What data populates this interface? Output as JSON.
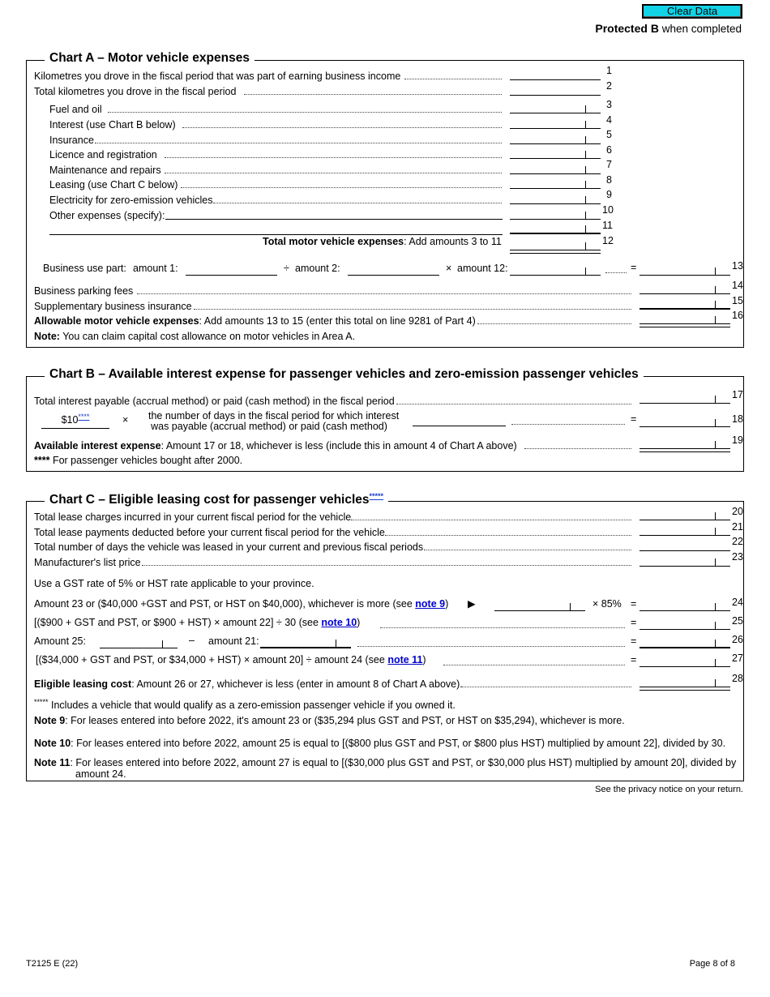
{
  "header": {
    "clear_button": "Clear Data",
    "protected_bold": "Protected B",
    "protected_rest": " when completed"
  },
  "chart_a": {
    "title": "Chart A – Motor vehicle expenses",
    "lines": [
      {
        "num": "1",
        "label": "Kilometres you drove in the fiscal period that was part of earning business income"
      },
      {
        "num": "2",
        "label": "Total kilometres you drove in the fiscal period"
      },
      {
        "num": "3",
        "label": "Fuel and oil"
      },
      {
        "num": "4",
        "label": "Interest (use Chart B below)"
      },
      {
        "num": "5",
        "label": "Insurance"
      },
      {
        "num": "6",
        "label": "Licence and registration"
      },
      {
        "num": "7",
        "label": "Maintenance and repairs"
      },
      {
        "num": "8",
        "label": "Leasing (use Chart C below)"
      },
      {
        "num": "9",
        "label": "Electricity for zero-emission vehicles"
      },
      {
        "num": "10",
        "label": "Other expenses (specify):"
      },
      {
        "num": "11",
        "label": ""
      },
      {
        "num": "12",
        "label_bold": "Total motor vehicle expenses",
        "label_rest": ": Add amounts 3 to 11"
      }
    ],
    "business_use": {
      "label": "Business use part:",
      "amount1": "amount 1:",
      "divide": "÷",
      "amount2": "amount 2:",
      "times": "×",
      "amount12": "amount 12:",
      "equals": "=",
      "num": "13"
    },
    "line14": {
      "num": "14",
      "label": "Business parking fees"
    },
    "line15": {
      "num": "15",
      "label": "Supplementary business insurance"
    },
    "line16": {
      "num": "16",
      "label_bold": "Allowable motor vehicle expenses",
      "label_rest": ": Add amounts 13 to 15 (enter this total on line 9281 of Part 4)"
    },
    "note_bold": "Note:",
    "note_rest": " You can claim capital cost allowance on motor vehicles in Area A."
  },
  "chart_b": {
    "title": "Chart B – Available interest expense for passenger vehicles and zero-emission passenger vehicles",
    "line17": {
      "num": "17",
      "label": "Total interest payable (accrual method) or paid (cash method) in the fiscal period"
    },
    "line18": {
      "num": "18",
      "amount": "$10",
      "stars": "****",
      "times": "×",
      "desc_line1": "the number of days in the fiscal period for which interest",
      "desc_line2": "was payable (accrual method) or paid (cash method)",
      "equals": "="
    },
    "line19": {
      "num": "19",
      "label_bold": "Available interest expense",
      "label_rest": ": Amount 17 or 18, whichever is less (include this in amount 4 of Chart A above)"
    },
    "footnote_stars": "****",
    "footnote": " For passenger vehicles bought after 2000."
  },
  "chart_c": {
    "title": "Chart C – Eligible leasing cost for passenger vehicles",
    "title_stars": "*****",
    "line20": {
      "num": "20",
      "label": "Total lease charges incurred in your current fiscal period for the vehicle"
    },
    "line21": {
      "num": "21",
      "label": "Total lease payments deducted before your current fiscal period for the vehicle"
    },
    "line22": {
      "num": "22",
      "label": "Total number of days the vehicle was leased in your current and previous fiscal periods"
    },
    "line23": {
      "num": "23",
      "label": "Manufacturer's list price"
    },
    "gst_note": "Use a GST rate of 5% or HST rate applicable to your province.",
    "line24": {
      "num": "24",
      "label": "Amount 23 or ($40,000 +GST and PST, or HST on $40,000), whichever is more (see ",
      "link": "note 9",
      "close": ")",
      "arrow": "▶",
      "mult": "× 85%",
      "equals": "="
    },
    "line25": {
      "num": "25",
      "label": "[($900 + GST and PST, or $900 + HST) × amount 22]  ÷ 30 (see ",
      "link": "note 10",
      "close": ")",
      "equals": "="
    },
    "line26": {
      "num": "26",
      "label": "Amount 25:",
      "minus": "–",
      "label2": "amount 21:",
      "equals": "="
    },
    "line27": {
      "num": "27",
      "label": "[($34,000 + GST and PST, or $34,000 + HST) ×  amount 20]  ÷  amount 24 (see ",
      "link": "note 11",
      "close": ")",
      "equals": "="
    },
    "line28": {
      "num": "28",
      "label_bold": "Eligible leasing cost",
      "label_rest": ": Amount 26 or 27, whichever is less (enter in amount 8 of Chart A above)."
    },
    "footnote_stars": "*****",
    "footnote": " Includes a vehicle that would qualify as a zero-emission passenger vehicle if you owned it.",
    "note9_bold": "Note 9",
    "note9": ": For leases entered into before 2022, it's amount 23 or ($35,294 plus GST and PST, or HST on $35,294), whichever is more.",
    "note10_bold": "Note 10",
    "note10": ": For leases entered into before 2022, amount 25 is equal to [($800 plus GST and PST, or $800 plus HST) multiplied by amount 22], divided by 30.",
    "note11_bold": "Note 11",
    "note11_a": ": For leases entered into before 2022, amount 27 is equal to [($30,000 plus GST and PST, or $30,000 plus HST) multiplied by amount 20], divided by",
    "note11_b": "amount 24."
  },
  "privacy": "See the privacy notice on your return.",
  "footer": {
    "form_id": "T2125 E (22)",
    "page": "Page 8 of 8"
  }
}
